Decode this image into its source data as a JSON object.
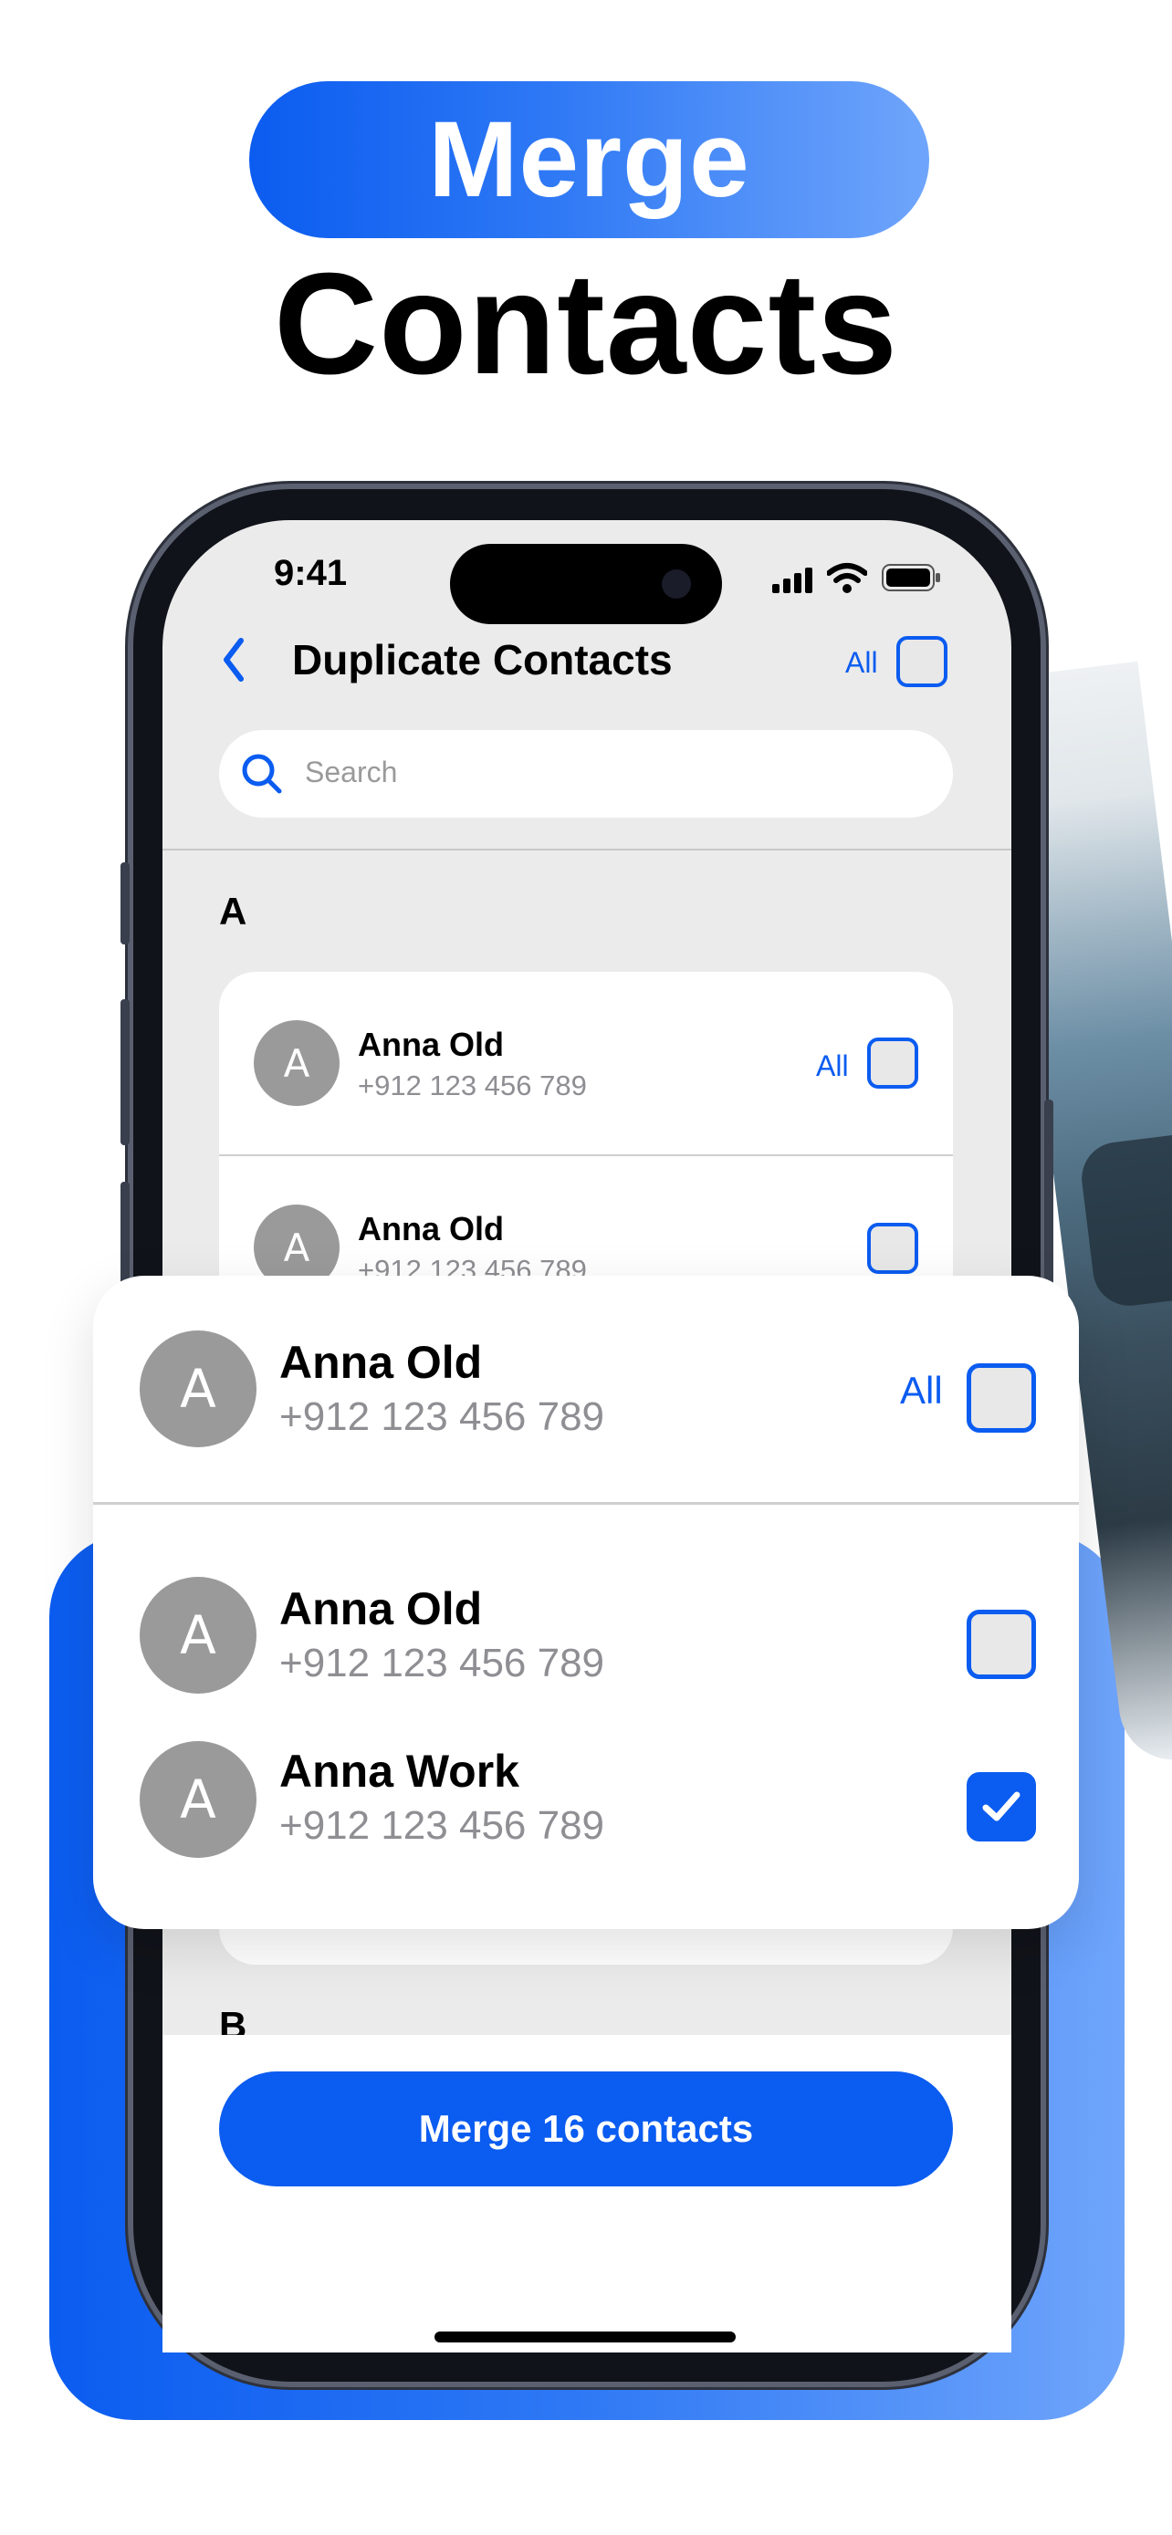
{
  "headline": {
    "pill_text": "Merge",
    "title": "Contacts"
  },
  "status_bar": {
    "time": "9:41"
  },
  "nav": {
    "title": "Duplicate Contacts",
    "all_label": "All"
  },
  "search": {
    "placeholder": "Search"
  },
  "sections": {
    "a": "A",
    "b": "B"
  },
  "background_list": [
    {
      "initial": "A",
      "name": "Anna Old",
      "phone": "+912 123 456 789",
      "all_label": "All"
    },
    {
      "initial": "A",
      "name": "Anna Old",
      "phone": "+912 123 456 789"
    }
  ],
  "front_card": {
    "primary": {
      "initial": "A",
      "name": "Anna Old",
      "phone": "+912 123 456 789",
      "all_label": "All"
    },
    "items": [
      {
        "initial": "A",
        "name": "Anna Old",
        "phone": "+912 123 456 789",
        "checked": false
      },
      {
        "initial": "A",
        "name": "Anna Work",
        "phone": "+912 123 456 789",
        "checked": true
      }
    ]
  },
  "merge_button": {
    "label": "Merge 16 contacts"
  },
  "colors": {
    "accent": "#0b5cf0",
    "avatar": "#9a9a9a"
  }
}
